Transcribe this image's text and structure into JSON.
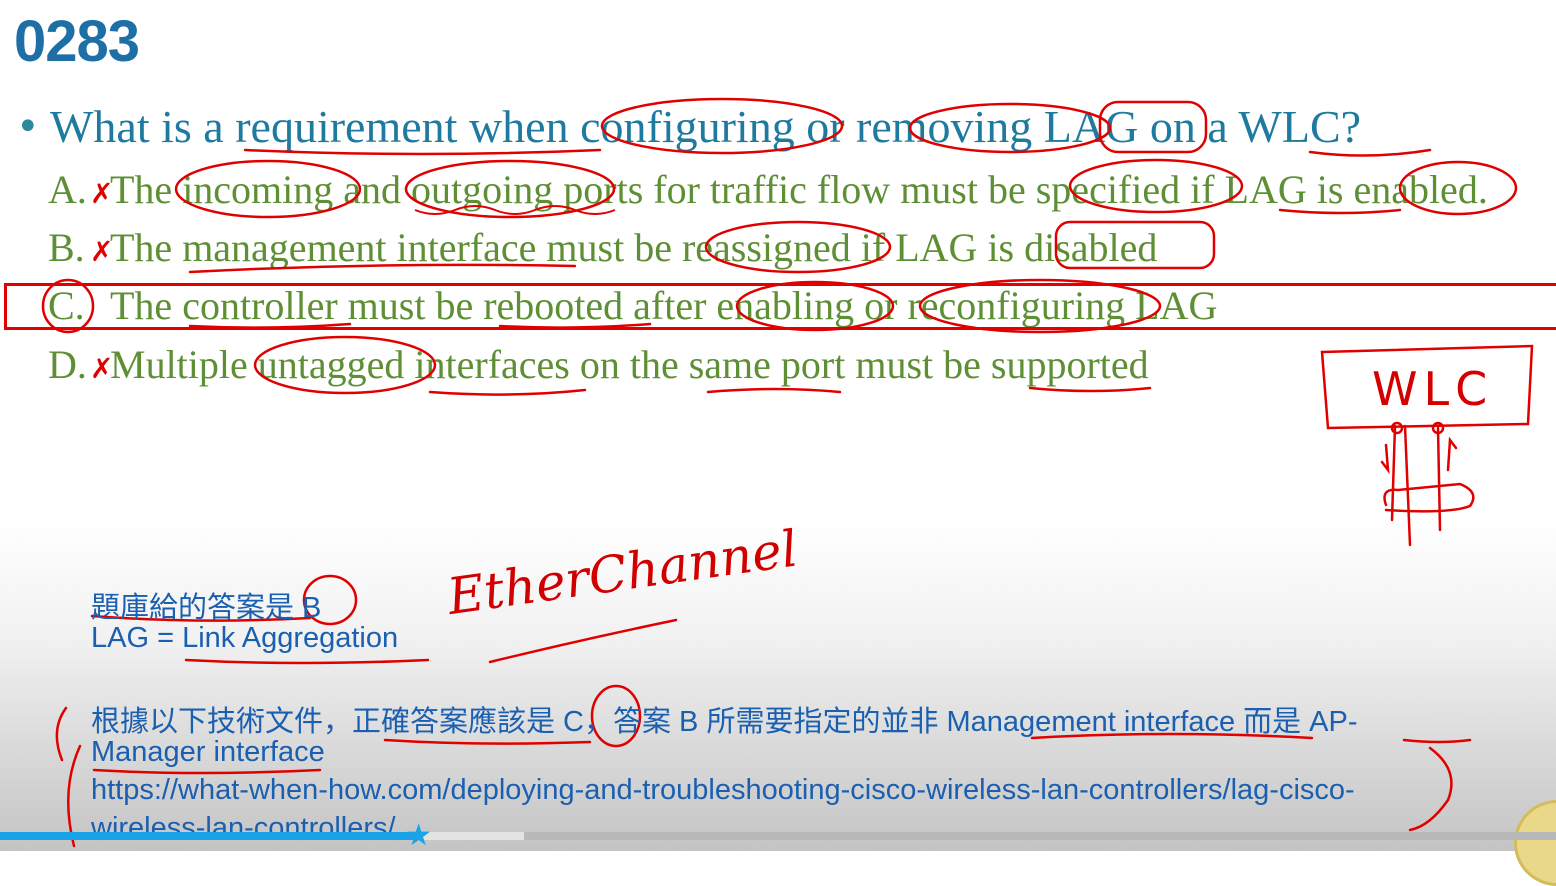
{
  "slide": {
    "number": "0283",
    "question": "What is a requirement when configuring or removing LAG on a WLC?",
    "options": [
      {
        "letter": "A.",
        "mark": "✗",
        "text": "The incoming and outgoing ports for traffic flow must be specified if LAG is enabled."
      },
      {
        "letter": "B.",
        "mark": "✗",
        "text": "The management interface must be reassigned if LAG is disabled"
      },
      {
        "letter": "C.",
        "mark": "",
        "text": "The controller must be rebooted after enabling or reconfiguring LAG"
      },
      {
        "letter": "D.",
        "mark": "✗",
        "text": "Multiple untagged interfaces on the same port must be supported"
      }
    ]
  },
  "annotations": {
    "wlc_label": "WLC",
    "etherchannel": "EtherChannel"
  },
  "notes": {
    "line1": "題庫給的答案是 B",
    "line2": "LAG = Link Aggregation",
    "line3": "根據以下技術文件，正確答案應該是 C，答案 B 所需要指定的並非 Management interface 而是 AP-",
    "line4": "Manager interface",
    "line5": "https://what-when-how.com/deploying-and-troubleshooting-cisco-wireless-lan-controllers/lag-cisco-",
    "line6": "wireless-lan-controllers/"
  },
  "player": {
    "progress_fraction": 0.269,
    "buffered_fraction": 0.337,
    "thumb_icon": "star-icon"
  },
  "colors": {
    "title": "#1d6fa5",
    "question": "#1f7aa0",
    "options": "#5e8f34",
    "ink": "#e00000",
    "notes": "#1a5fb0",
    "progress": "#1aa3e8"
  }
}
